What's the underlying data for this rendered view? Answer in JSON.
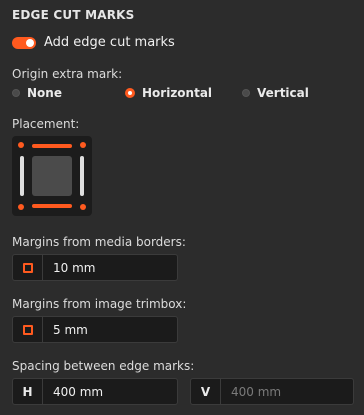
{
  "section": {
    "title": "EDGE CUT MARKS"
  },
  "toggle": {
    "label": "Add edge cut marks",
    "on": true
  },
  "origin": {
    "label": "Origin extra mark:",
    "options": [
      {
        "label": "None",
        "selected": false
      },
      {
        "label": "Horizontal",
        "selected": true
      },
      {
        "label": "Vertical",
        "selected": false
      }
    ]
  },
  "placement": {
    "label": "Placement:"
  },
  "media_margins": {
    "label": "Margins from media borders:",
    "value": "10 mm",
    "icon": "margin-icon"
  },
  "trimbox_margins": {
    "label": "Margins from image trimbox:",
    "value": "5 mm",
    "icon": "margin-icon"
  },
  "spacing": {
    "label": "Spacing between edge marks:",
    "h_prefix": "H",
    "h_value": "400 mm",
    "v_prefix": "V",
    "v_value": "400 mm"
  },
  "colors": {
    "accent": "#ff5a1f",
    "background": "#2c2c2c",
    "field_bg": "#1b1b1b"
  }
}
